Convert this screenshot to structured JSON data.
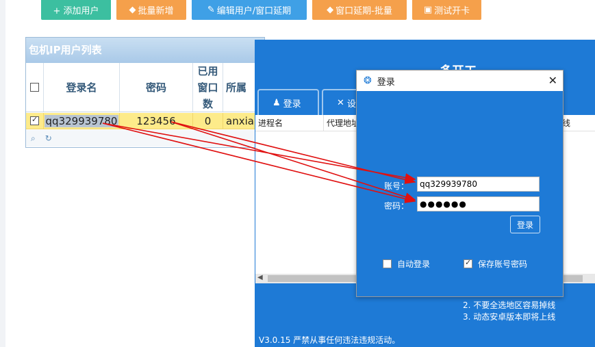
{
  "toolbar": {
    "add_user": "+ 添加用户",
    "batch_add": "批量新增",
    "edit_user": "编辑用户/窗口延期",
    "extend_batch": "窗口延期-批量",
    "test_card": "测试开卡"
  },
  "grid": {
    "title": "包机IP用户列表",
    "headers": [
      "登录名",
      "密码",
      "已用窗口数",
      "所属"
    ],
    "rows": [
      {
        "login": "qq329939780",
        "password": "123456",
        "used": "0",
        "owner": "anxia"
      }
    ]
  },
  "app": {
    "title": "多开工",
    "tabs": [
      "登录",
      "设"
    ],
    "list_headers": [
      "进程名",
      "代理地址"
    ],
    "partial_right": "线",
    "notes": [
      "2. 不要全选地区容易掉线",
      "3. 动态安卓版本即将上线"
    ],
    "version": "V3.0.15 严禁从事任何违法违规活动。"
  },
  "dialog": {
    "title": "登录",
    "account_label": "账号：",
    "account_value": "qq329939780",
    "password_label": "密码：",
    "password_mask": "●●●●●●",
    "login_button": "登录",
    "auto_login": "自动登录",
    "save_password": "保存账号密码",
    "auto_login_checked": false,
    "save_password_checked": true
  },
  "colors": {
    "accent_blue": "#1e7ad6",
    "row_highlight": "#fdeb8a",
    "arrow_red": "#e01010"
  }
}
